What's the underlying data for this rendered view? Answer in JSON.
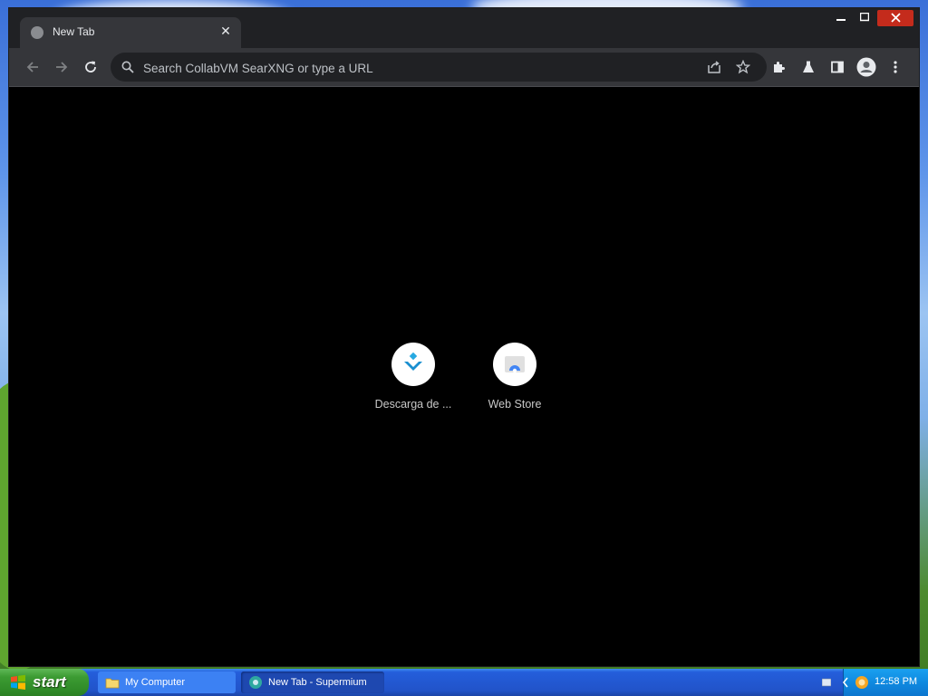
{
  "browser": {
    "tab": {
      "title": "New Tab",
      "close_glyph": "✕"
    },
    "window_controls": {
      "minimize_glyph": "—",
      "maximize_glyph": "☐",
      "close_glyph": "✕"
    },
    "omnibox": {
      "placeholder": "Search CollabVM SearXNG or type a URL"
    },
    "shortcuts": [
      {
        "label": "Descarga de ...",
        "icon": "download-arrow-icon"
      },
      {
        "label": "Web Store",
        "icon": "web-store-icon"
      }
    ],
    "colors": {
      "frame": "#202124",
      "toolbar": "#35363a",
      "content": "#000000",
      "close_button": "#c42b1c"
    }
  },
  "taskbar": {
    "start_label": "start",
    "tasks": [
      {
        "label": "My Computer",
        "icon": "folder-icon"
      },
      {
        "label": "New Tab - Supermium",
        "icon": "browser-icon"
      }
    ],
    "clock": "12:58 PM"
  }
}
